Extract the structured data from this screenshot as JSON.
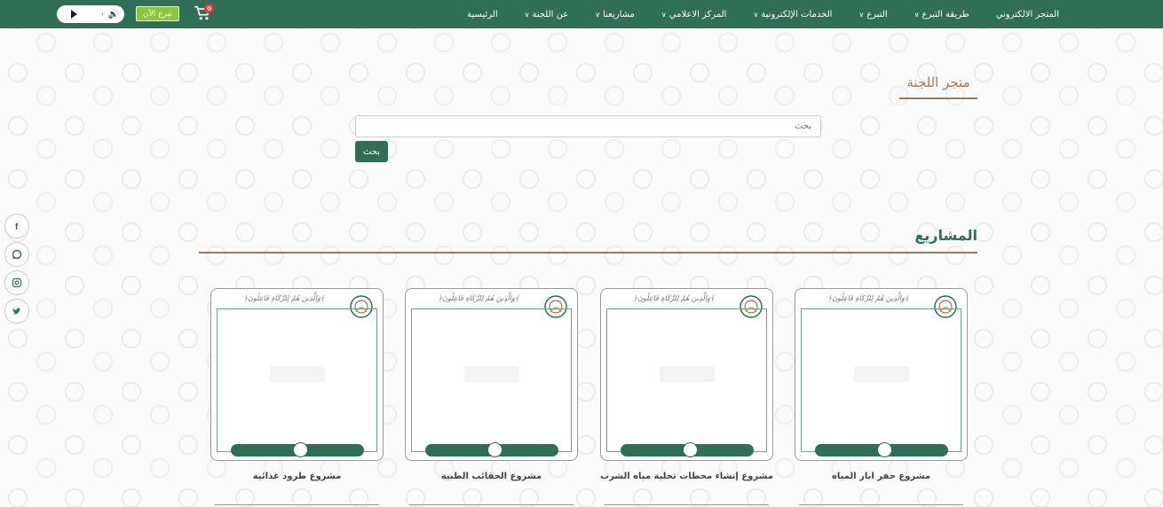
{
  "nav": {
    "items": [
      {
        "label": "الرئيسية",
        "dropdown": false
      },
      {
        "label": "عن اللجنة",
        "dropdown": true
      },
      {
        "label": "مشاريعنا",
        "dropdown": true
      },
      {
        "label": "المركز الاعلامي",
        "dropdown": true
      },
      {
        "label": "الخدمات الإلكترونية",
        "dropdown": true
      },
      {
        "label": "التبرع",
        "dropdown": true
      },
      {
        "label": "طريقة التبرع",
        "dropdown": true
      },
      {
        "label": "المتجر الالكتروني",
        "dropdown": false
      }
    ],
    "donate_now": "تبرع الآن",
    "cart_count": "0"
  },
  "store": {
    "title": "متجر اللجنة",
    "search_placeholder": "بحث",
    "search_button": "بحث"
  },
  "social": [
    "facebook-icon",
    "whatsapp-icon",
    "instagram-icon",
    "twitter-icon"
  ],
  "projects": {
    "title": "المشاريع",
    "items": [
      {
        "name": "مشروع حفر ابار المياه"
      },
      {
        "name": "مشروع إنشاء محطات تحلية مياه الشرب"
      },
      {
        "name": "مشروع الحقائب الطبية"
      },
      {
        "name": "مشروع طرود غذائية"
      }
    ]
  },
  "colors": {
    "primary": "#2e6f55",
    "accent": "#a07b56",
    "donate": "#8cc63f"
  }
}
